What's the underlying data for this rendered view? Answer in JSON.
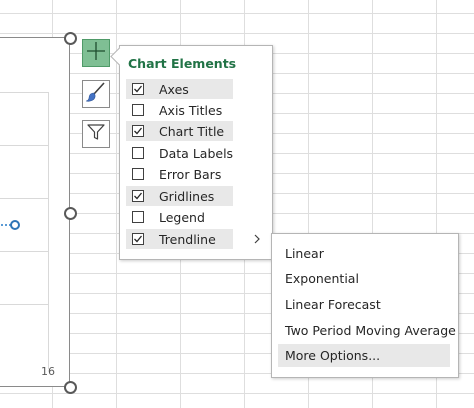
{
  "chart": {
    "axis_tick_label": "16",
    "series_color": "#5b9bd5"
  },
  "side_buttons": [
    {
      "icon": "plus-icon",
      "active": true
    },
    {
      "icon": "paintbrush-icon",
      "active": false
    },
    {
      "icon": "funnel-icon",
      "active": false
    }
  ],
  "chart_elements": {
    "title": "Chart Elements",
    "title_color": "#217346",
    "items": [
      {
        "label": "Axes",
        "checked": true
      },
      {
        "label": "Axis Titles",
        "checked": false
      },
      {
        "label": "Chart Title",
        "checked": true
      },
      {
        "label": "Data Labels",
        "checked": false
      },
      {
        "label": "Error Bars",
        "checked": false
      },
      {
        "label": "Gridlines",
        "checked": true
      },
      {
        "label": "Legend",
        "checked": false
      },
      {
        "label": "Trendline",
        "checked": true
      }
    ]
  },
  "trendline_submenu": {
    "items": [
      {
        "label": "Linear"
      },
      {
        "label": "Exponential"
      },
      {
        "label": "Linear Forecast"
      },
      {
        "label": "Two Period Moving Average"
      },
      {
        "label": "More Options..."
      }
    ]
  }
}
